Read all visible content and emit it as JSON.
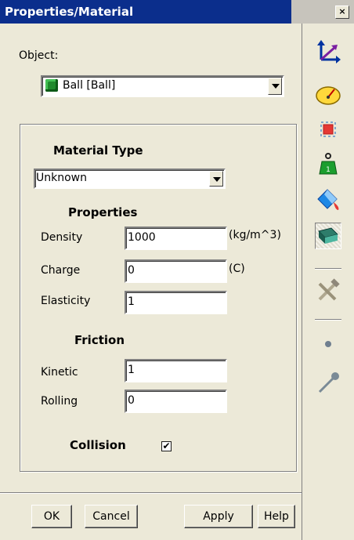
{
  "window": {
    "title": "Properties/Material",
    "close_label": "×"
  },
  "object": {
    "label": "Object:",
    "selected": "Ball  [Ball]"
  },
  "material": {
    "heading": "Material Type",
    "selected": "Unknown"
  },
  "properties": {
    "heading": "Properties",
    "density_label": "Density",
    "density_value": "1000",
    "density_unit": "(kg/m^3)",
    "charge_label": "Charge",
    "charge_value": "0",
    "charge_unit": "(C)",
    "elasticity_label": "Elasticity",
    "elasticity_value": "1"
  },
  "friction": {
    "heading": "Friction",
    "kinetic_label": "Kinetic",
    "kinetic_value": "1",
    "rolling_label": "Rolling",
    "rolling_value": "0"
  },
  "collision": {
    "label": "Collision",
    "checked": true,
    "check_glyph": "✔"
  },
  "buttons": {
    "ok": "OK",
    "cancel": "Cancel",
    "apply": "Apply",
    "help": "Help"
  },
  "toolbar": {
    "items": [
      "coordinates-icon",
      "speedometer-icon",
      "geometry-icon",
      "mass-icon",
      "appearance-icon",
      "material-icon",
      "tools-icon",
      "point-icon",
      "pin-icon"
    ],
    "active": "material-icon"
  }
}
